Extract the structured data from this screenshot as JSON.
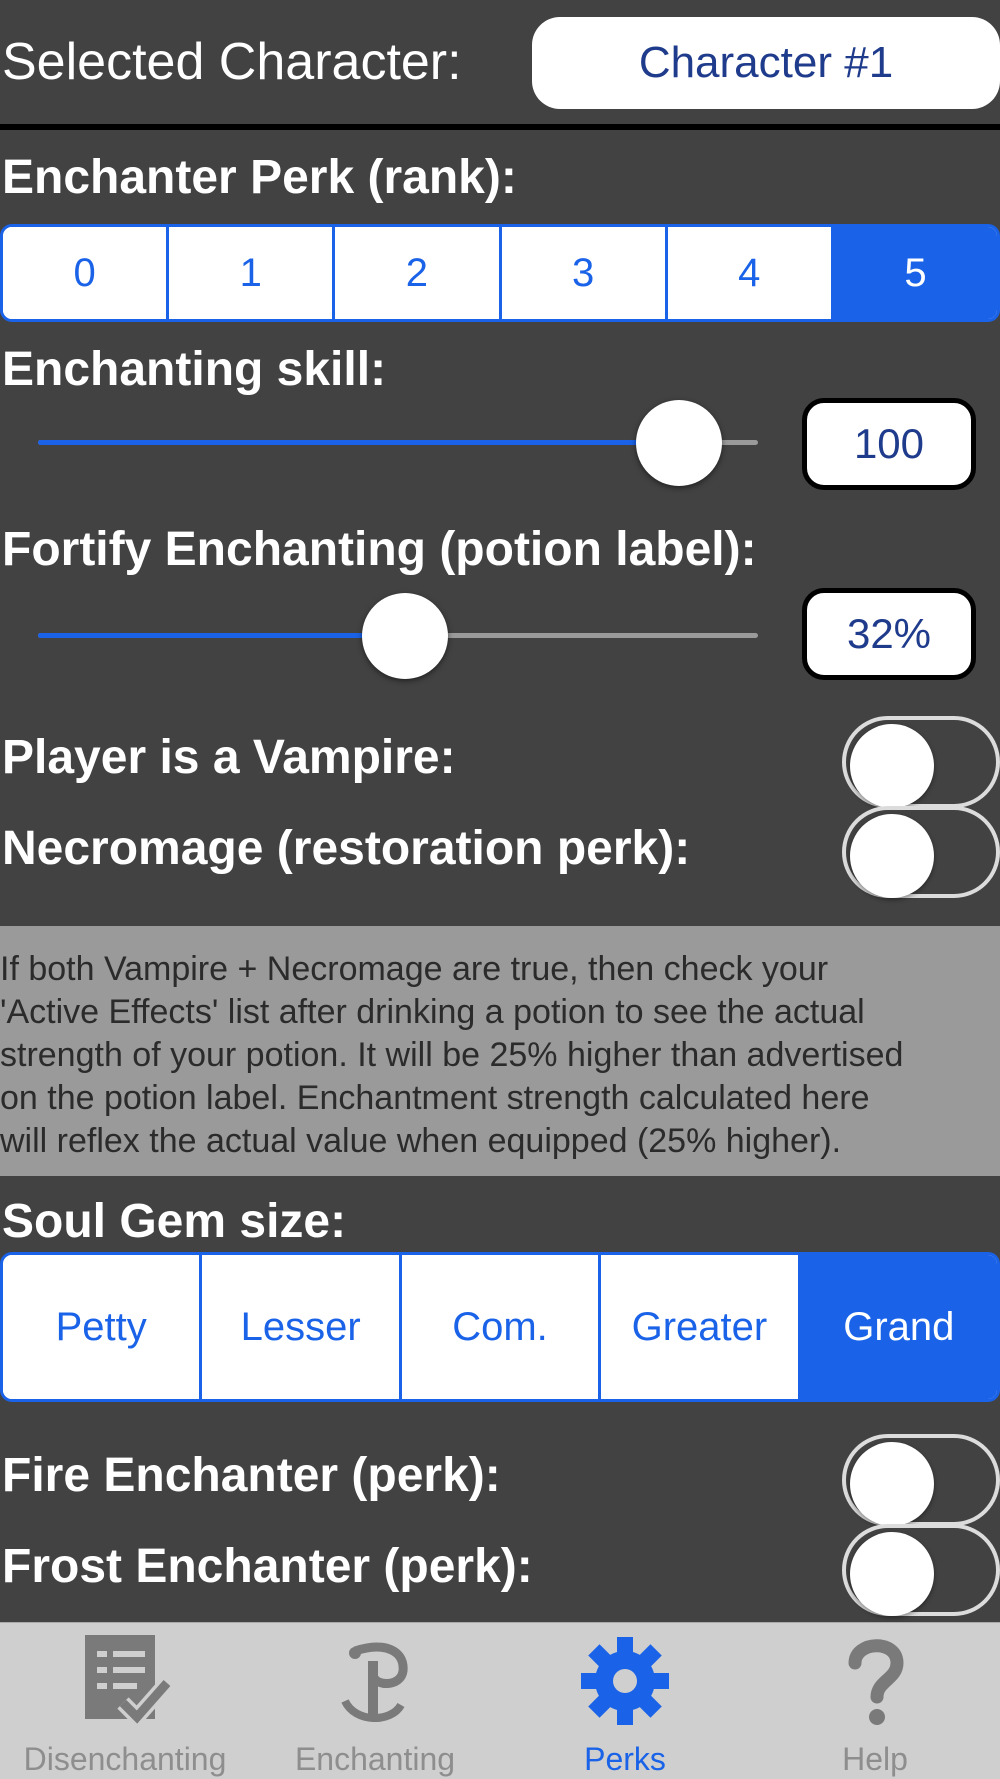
{
  "header": {
    "label": "Selected Character:",
    "character_button": "Character #1"
  },
  "enchanter_perk": {
    "label": "Enchanter Perk (rank):",
    "options": [
      "0",
      "1",
      "2",
      "3",
      "4",
      "5"
    ],
    "selected": "5"
  },
  "enchanting_skill": {
    "label": "Enchanting skill:",
    "value_text": "100",
    "slider_fraction": 0.89
  },
  "fortify_enchanting": {
    "label": "Fortify Enchanting (potion label):",
    "value_text": "32%",
    "slider_fraction": 0.51
  },
  "vampire": {
    "label": "Player is a Vampire:",
    "on": false
  },
  "necromage": {
    "label": "Necromage (restoration perk):",
    "on": false
  },
  "note": {
    "lines": [
      "If both Vampire + Necromage are true, then check your",
      "'Active Effects' list after drinking a potion to see the actual",
      "strength of your potion. It will be 25% higher than advertised",
      "on the potion label. Enchantment strength calculated here",
      "will reflex the actual value when equipped (25% higher)."
    ]
  },
  "soul_gem": {
    "label": "Soul Gem size:",
    "options": [
      "Petty",
      "Lesser",
      "Com.",
      "Greater",
      "Grand"
    ],
    "selected": "Grand"
  },
  "fire_enchanter": {
    "label": "Fire Enchanter (perk):",
    "on": false
  },
  "frost_enchanter": {
    "label": "Frost Enchanter (perk):",
    "on": false
  },
  "tabbar": {
    "tabs": [
      {
        "label": "Disenchanting",
        "icon": "disenchant-checklist-icon",
        "active": false
      },
      {
        "label": "Enchanting",
        "icon": "enchanting-scroll-icon",
        "active": false
      },
      {
        "label": "Perks",
        "icon": "gear-icon",
        "active": true
      },
      {
        "label": "Help",
        "icon": "question-mark-icon",
        "active": false
      }
    ]
  },
  "colors": {
    "accent": "#1a63e8",
    "background": "#424242",
    "note_bg": "#9a9a9a",
    "text_dark": "#1f3b8c"
  }
}
